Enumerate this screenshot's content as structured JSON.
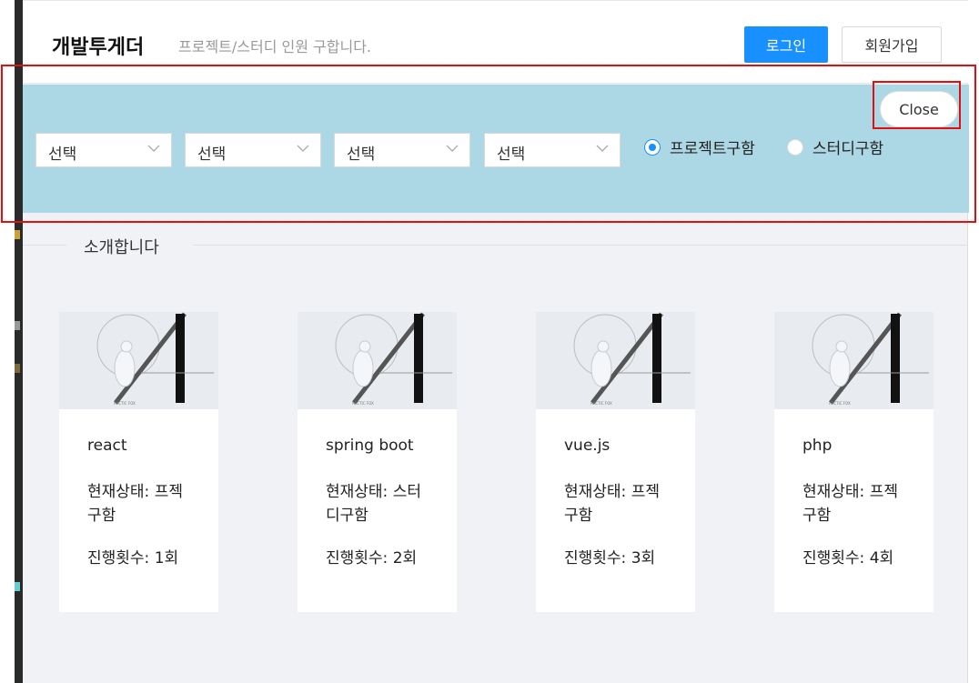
{
  "header": {
    "logo": "개발투게더",
    "tagline": "프로젝트/스터디 인원 구합니다.",
    "login_label": "로그인",
    "signup_label": "회원가입",
    "accent_color": "#1890ff"
  },
  "filters": {
    "selects": [
      {
        "value": "선택"
      },
      {
        "value": "선택"
      },
      {
        "value": "선택"
      },
      {
        "value": "선택"
      }
    ],
    "radios": [
      {
        "label": "프로젝트구함",
        "checked": true
      },
      {
        "label": "스터디구함",
        "checked": false
      }
    ],
    "close_label": "Close",
    "panel_color": "#acd7e5"
  },
  "section": {
    "title": "소개합니다"
  },
  "cards": [
    {
      "image_caption": "ARCTIC FOX",
      "title": "react",
      "status": "현재상태: 프젝구함",
      "count": "진행횟수: 1회"
    },
    {
      "image_caption": "ARCTIC FOX",
      "title": "spring boot",
      "status": "현재상태: 스터디구함",
      "count": "진행횟수: 2회"
    },
    {
      "image_caption": "ARCTIC FOX",
      "title": "vue.js",
      "status": "현재상태: 프젝구함",
      "count": "진행횟수: 3회"
    },
    {
      "image_caption": "ARCTIC FOX",
      "title": "php",
      "status": "현재상태: 프젝구함",
      "count": "진행횟수: 4회"
    }
  ]
}
